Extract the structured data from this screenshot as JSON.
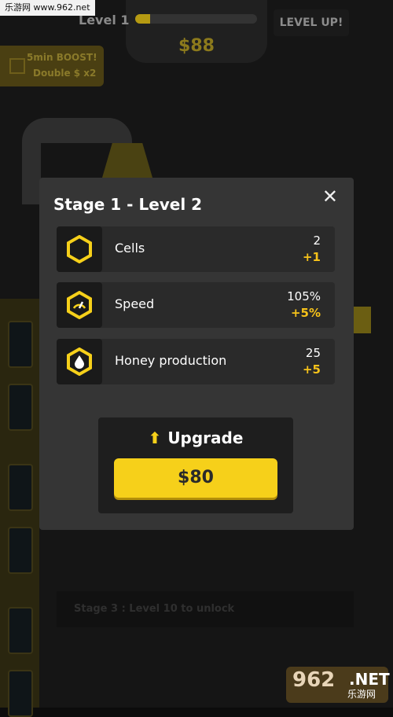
{
  "watermark_top": "乐游网 www.962.net",
  "watermark_bottom": {
    "number": "962",
    "suffix": ".NET",
    "sub": "乐游网"
  },
  "hud": {
    "level_label": "Level 1",
    "level_progress": 0.12,
    "money": "$88",
    "level_up_label": "LEVEL UP!"
  },
  "boost": {
    "line1": "5min BOOST!",
    "line2": "Double $ x2"
  },
  "stage3_locked": "Stage 3 : Level 10 to unlock",
  "modal": {
    "title": "Stage 1 - Level 2",
    "close_icon": "close-icon",
    "stats": [
      {
        "label": "Cells",
        "value": "2",
        "increase": "+1",
        "icon": "hexagon-icon"
      },
      {
        "label": "Speed",
        "value": "105%",
        "increase": "+5%",
        "icon": "speedometer-hex-icon"
      },
      {
        "label": "Honey production",
        "value": "25",
        "increase": "+5",
        "icon": "honey-drop-hex-icon"
      }
    ],
    "upgrade": {
      "label": "Upgrade",
      "price": "$80",
      "icon": "arrow-up-icon"
    }
  },
  "colors": {
    "accent": "#f6d01a",
    "increase": "#f6c21a",
    "modal_bg": "#353535"
  }
}
